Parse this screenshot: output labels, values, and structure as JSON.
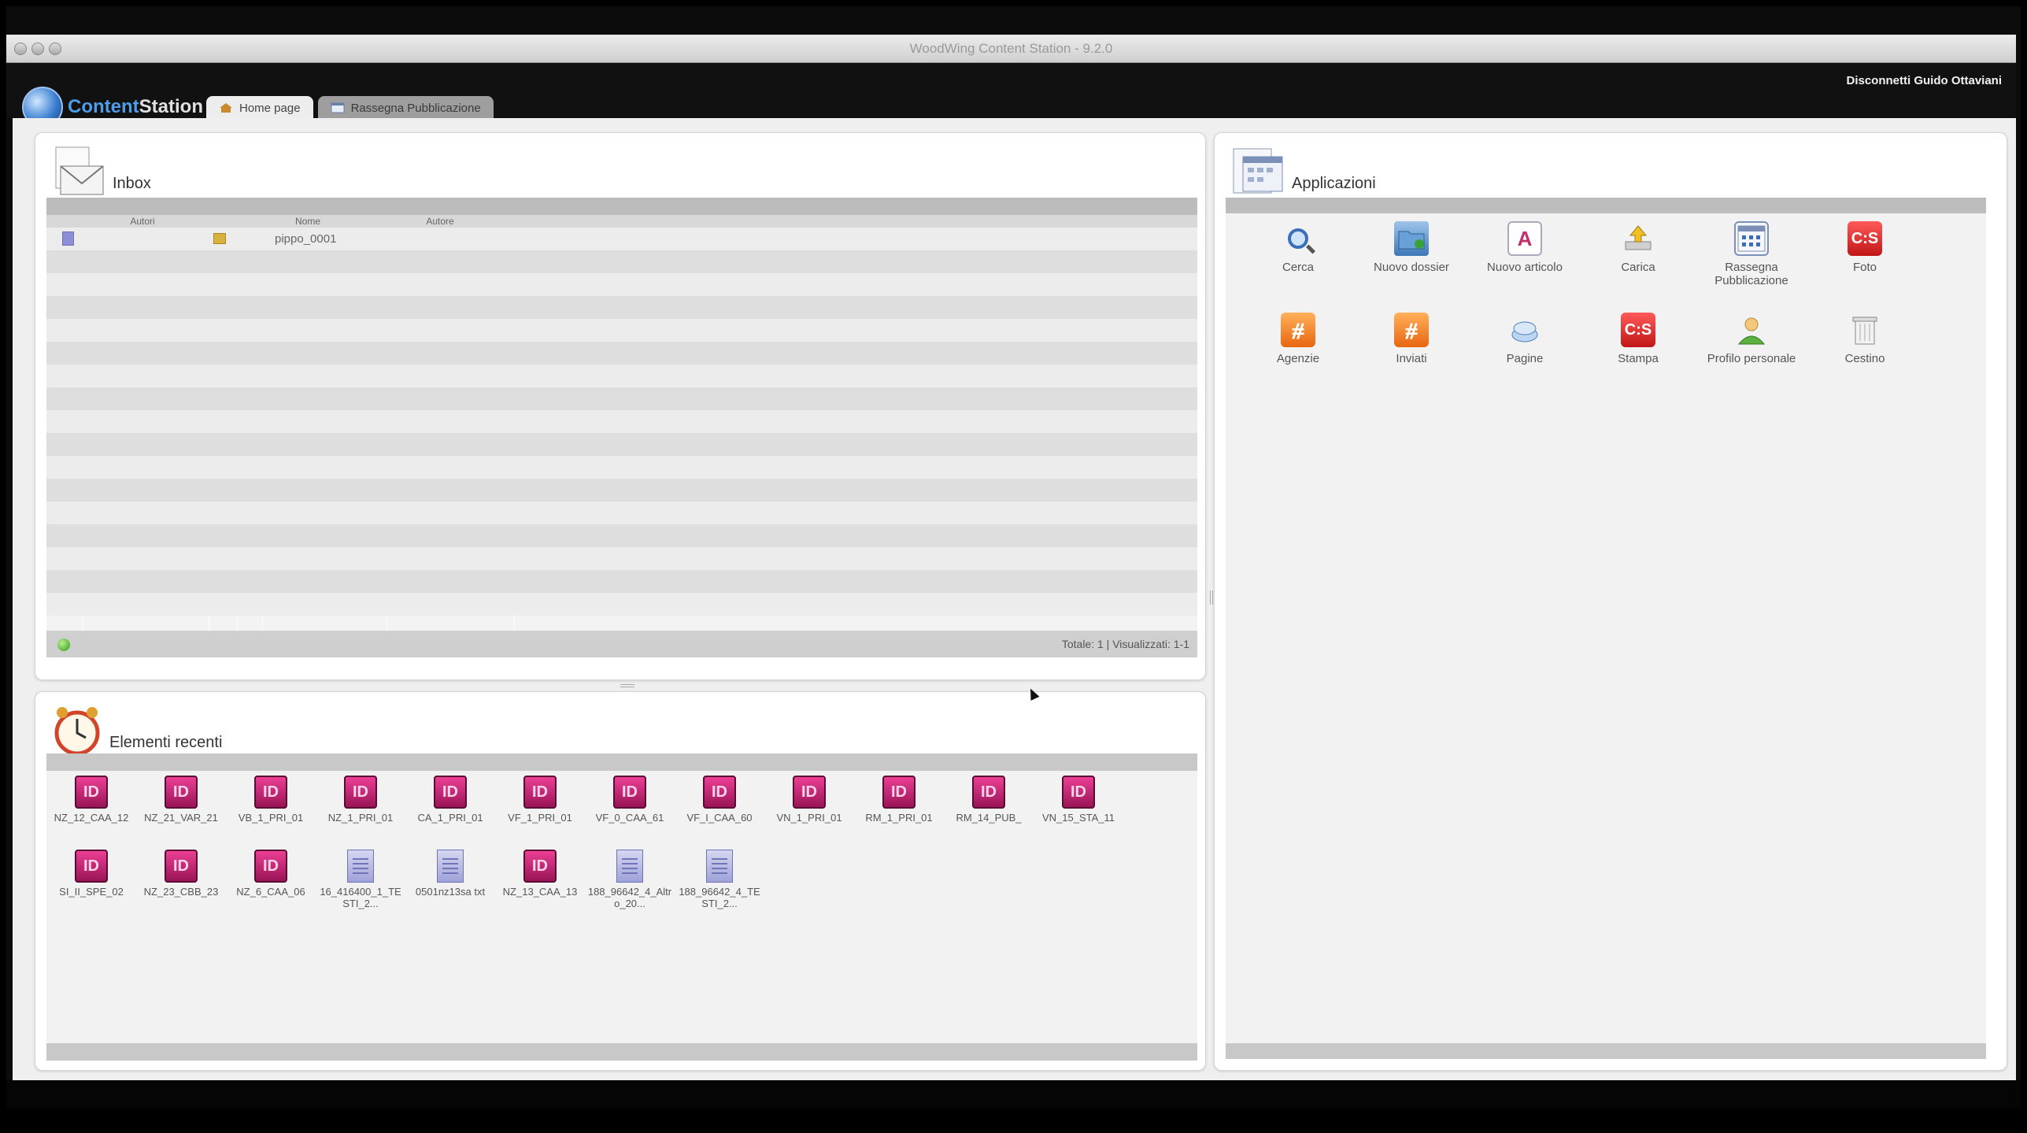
{
  "window": {
    "title": "WoodWing Content Station - 9.2.0"
  },
  "app": {
    "logo_part1": "Content",
    "logo_part2": "Station",
    "logout_label": "Disconnetti Guido Ottaviani",
    "tabs": [
      {
        "label": "Home page",
        "icon": "home-icon",
        "active": true
      },
      {
        "label": "Rassegna Pubblicazione",
        "icon": "calendar-icon",
        "active": false
      }
    ]
  },
  "inbox": {
    "title": "Inbox",
    "columns": [
      "Autori",
      "Nome",
      "Autore"
    ],
    "rows": [
      {
        "name": "pippo_0001"
      }
    ],
    "footer": "Totale: 1 | Visualizzati: 1-1"
  },
  "recent": {
    "title": "Elementi recenti",
    "items": [
      {
        "label": "NZ_12_CAA_12",
        "type": "indesign"
      },
      {
        "label": "NZ_21_VAR_21",
        "type": "indesign"
      },
      {
        "label": "VB_1_PRI_01",
        "type": "indesign"
      },
      {
        "label": "NZ_1_PRI_01",
        "type": "indesign"
      },
      {
        "label": "CA_1_PRI_01",
        "type": "indesign"
      },
      {
        "label": "VF_1_PRI_01",
        "type": "indesign"
      },
      {
        "label": "VF_0_CAA_61",
        "type": "indesign"
      },
      {
        "label": "VF_I_CAA_60",
        "type": "indesign"
      },
      {
        "label": "VN_1_PRI_01",
        "type": "indesign"
      },
      {
        "label": "RM_1_PRI_01",
        "type": "indesign"
      },
      {
        "label": "RM_14_PUB_",
        "type": "indesign"
      },
      {
        "label": "VN_15_STA_11",
        "type": "indesign"
      },
      {
        "label": "SI_II_SPE_02",
        "type": "indesign"
      },
      {
        "label": "NZ_23_CBB_23",
        "type": "indesign"
      },
      {
        "label": "NZ_6_CAA_06",
        "type": "indesign"
      },
      {
        "label": "16_416400_1_TESTI_2...",
        "type": "text"
      },
      {
        "label": "0501nz13sa txt",
        "type": "text"
      },
      {
        "label": "NZ_13_CAA_13",
        "type": "indesign"
      },
      {
        "label": "188_96642_4_Altro_20...",
        "type": "text"
      },
      {
        "label": "188_96642_4_TESTI_2...",
        "type": "text"
      }
    ]
  },
  "applications": {
    "title": "Applicazioni",
    "items": [
      {
        "label": "Cerca",
        "icon": "search-icon"
      },
      {
        "label": "Nuovo dossier",
        "icon": "new-dossier-icon"
      },
      {
        "label": "Nuovo articolo",
        "icon": "new-article-icon"
      },
      {
        "label": "Carica",
        "icon": "upload-icon"
      },
      {
        "label": "Rassegna Pubblicazione",
        "icon": "calendar-icon"
      },
      {
        "label": "Foto",
        "icon": "cs-photo-icon"
      },
      {
        "label": "Agenzie",
        "icon": "rss-icon"
      },
      {
        "label": "Inviati",
        "icon": "rss-icon"
      },
      {
        "label": "Pagine",
        "icon": "pages-icon"
      },
      {
        "label": "Stampa",
        "icon": "cs-print-icon"
      },
      {
        "label": "Profilo personale",
        "icon": "user-icon"
      },
      {
        "label": "Cestino",
        "icon": "trash-icon"
      }
    ]
  }
}
